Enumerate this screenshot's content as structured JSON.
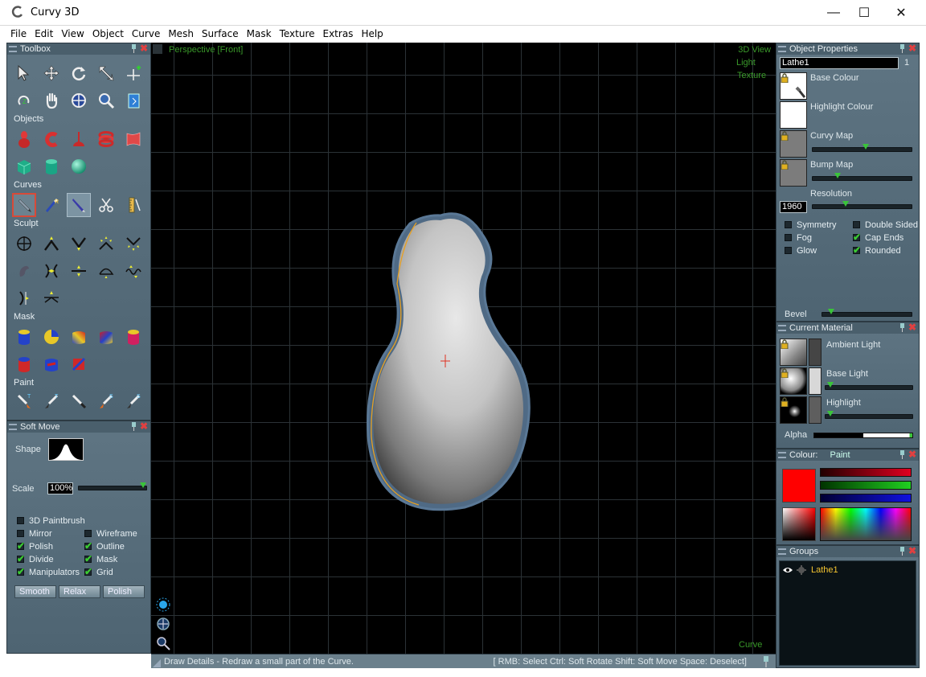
{
  "window": {
    "title": "Curvy 3D"
  },
  "menu": [
    "File",
    "Edit",
    "View",
    "Object",
    "Curve",
    "Mesh",
    "Surface",
    "Mask",
    "Texture",
    "Extras",
    "Help"
  ],
  "toolbox": {
    "title": "Toolbox",
    "sections": {
      "objects": "Objects",
      "curves": "Curves",
      "sculpt": "Sculpt",
      "mask": "Mask",
      "paint": "Paint"
    }
  },
  "soft_move": {
    "title": "Soft Move",
    "shape_label": "Shape",
    "scale_label": "Scale",
    "scale_value": "100%",
    "checkboxes": [
      {
        "label": "3D Paintbrush",
        "checked": false
      },
      {
        "label": "Wireframe",
        "checked": false
      },
      {
        "label": "Mirror",
        "checked": false
      },
      {
        "label": "Outline",
        "checked": true
      },
      {
        "label": "Polish",
        "checked": true
      },
      {
        "label": "Mask",
        "checked": true
      },
      {
        "label": "Divide",
        "checked": true
      },
      {
        "label": "Grid",
        "checked": true
      },
      {
        "label": "Manipulators",
        "checked": true
      }
    ],
    "buttons": [
      "Smooth",
      "Relax",
      "Polish"
    ]
  },
  "viewport": {
    "view_name": "Perspective [Front]",
    "modes": [
      "3D View",
      "Light",
      "Texture"
    ],
    "mode_bottom": "Curve"
  },
  "status": {
    "left": "Draw Details - Redraw a small part of the Curve.",
    "right": "[ RMB: Select   Ctrl: Soft Rotate   Shift: Soft Move   Space: Deselect]"
  },
  "object_properties": {
    "title": "Object Properties",
    "name": "Lathe1",
    "count": "1",
    "rows": [
      "Base Colour",
      "Highlight Colour",
      "Curvy Map",
      "Bump Map"
    ],
    "resolution_label": "Resolution",
    "resolution_value": "1960",
    "checkboxes": [
      {
        "label": "Symmetry",
        "checked": false
      },
      {
        "label": "Double Sided",
        "checked": false
      },
      {
        "label": "Fog",
        "checked": false
      },
      {
        "label": "Cap Ends",
        "checked": true
      },
      {
        "label": "Glow",
        "checked": false
      },
      {
        "label": "Rounded",
        "checked": true
      }
    ],
    "bevel_label": "Bevel"
  },
  "current_material": {
    "title": "Current Material",
    "rows": [
      "Ambient Light",
      "Base Light",
      "Highlight"
    ],
    "alpha_label": "Alpha"
  },
  "colour": {
    "title": "Colour:",
    "mode": "Paint",
    "value": "#ff0000"
  },
  "groups": {
    "title": "Groups",
    "items": [
      "Lathe1"
    ]
  },
  "colors": {
    "accent_green": "#3ac43a",
    "panel": "#546a78",
    "viewport_bg": "#000000"
  }
}
